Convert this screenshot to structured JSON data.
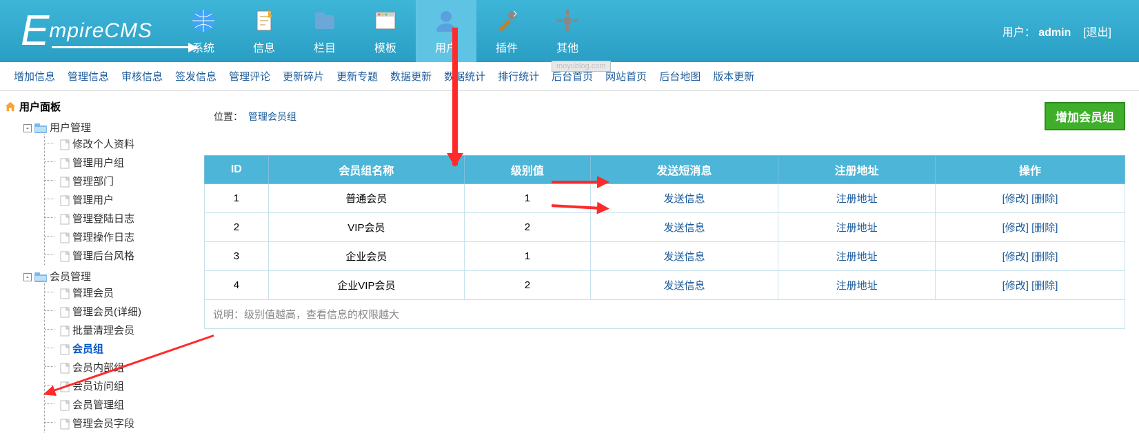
{
  "logo": {
    "big": "E",
    "rest": "mpireCMS"
  },
  "watermark": "moyublog.com",
  "userbar": {
    "label": "用户：",
    "name": "admin",
    "logout": "[退出]"
  },
  "topnav": [
    {
      "label": "系统",
      "icon": "globe"
    },
    {
      "label": "信息",
      "icon": "doc"
    },
    {
      "label": "栏目",
      "icon": "folder"
    },
    {
      "label": "模板",
      "icon": "window"
    },
    {
      "label": "用户",
      "icon": "user",
      "active": true
    },
    {
      "label": "插件",
      "icon": "tools"
    },
    {
      "label": "其他",
      "icon": "gear"
    }
  ],
  "subnav": [
    "增加信息",
    "管理信息",
    "审核信息",
    "签发信息",
    "管理评论",
    "更新碎片",
    "更新专题",
    "数据更新",
    "数据统计",
    "排行统计",
    "后台首页",
    "网站首页",
    "后台地图",
    "版本更新"
  ],
  "sidebar": {
    "title": "用户面板",
    "groups": [
      {
        "label": "用户管理",
        "items": [
          "修改个人资料",
          "管理用户组",
          "管理部门",
          "管理用户",
          "管理登陆日志",
          "管理操作日志",
          "管理后台风格"
        ]
      },
      {
        "label": "会员管理",
        "items": [
          "管理会员",
          "管理会员(详细)",
          "批量清理会员",
          "会员组",
          "会员内部组",
          "会员访问组",
          "会员管理组",
          "管理会员字段"
        ],
        "selected": "会员组"
      }
    ]
  },
  "crumb": {
    "loc": "位置：",
    "link": "管理会员组"
  },
  "addButton": "增加会员组",
  "table": {
    "headers": [
      "ID",
      "会员组名称",
      "级别值",
      "发送短消息",
      "注册地址",
      "操作"
    ],
    "rows": [
      {
        "id": "1",
        "name": "普通会员",
        "level": "1",
        "send": "发送信息",
        "reg": "注册地址",
        "edit": "[修改]",
        "del": "[删除]"
      },
      {
        "id": "2",
        "name": "VIP会员",
        "level": "2",
        "send": "发送信息",
        "reg": "注册地址",
        "edit": "[修改]",
        "del": "[删除]"
      },
      {
        "id": "3",
        "name": "企业会员",
        "level": "1",
        "send": "发送信息",
        "reg": "注册地址",
        "edit": "[修改]",
        "del": "[删除]"
      },
      {
        "id": "4",
        "name": "企业VIP会员",
        "level": "2",
        "send": "发送信息",
        "reg": "注册地址",
        "edit": "[修改]",
        "del": "[删除]"
      }
    ],
    "footer": "说明：级别值越高，查看信息的权限越大"
  }
}
